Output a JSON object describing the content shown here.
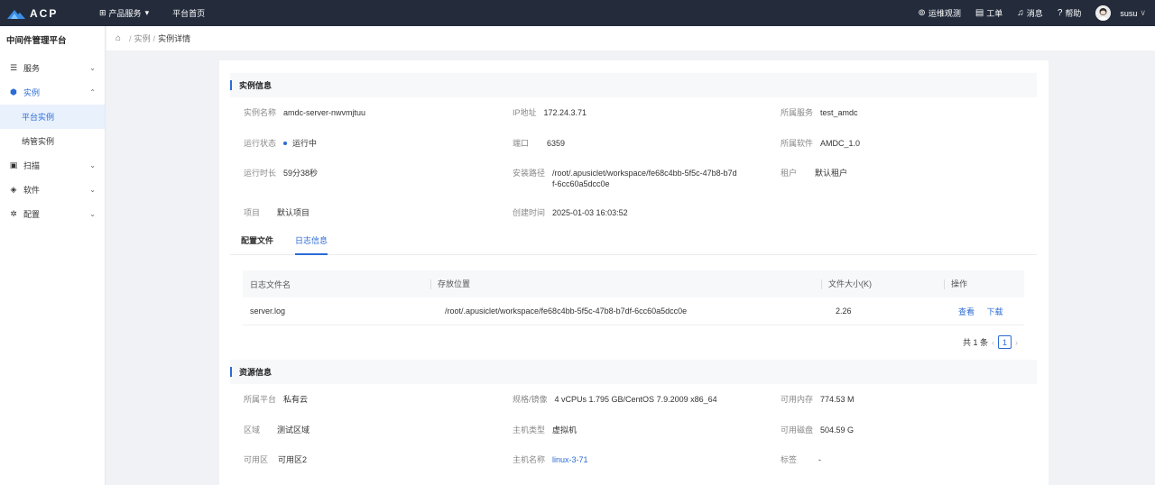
{
  "topbar": {
    "brand": "ACP",
    "nav": [
      {
        "icon": "grid-icon",
        "label": "产品服务",
        "caret": "▾"
      },
      {
        "label": "平台首页"
      }
    ],
    "right": [
      {
        "icon": "location-pin-icon",
        "label": "运维观测"
      },
      {
        "icon": "clipboard-icon",
        "label": "工单"
      },
      {
        "icon": "bell-icon",
        "label": "消息"
      },
      {
        "icon": "help-circle-icon",
        "label": "帮助"
      }
    ],
    "username": "susu",
    "user_caret": "∨"
  },
  "sidebar": {
    "title": "中间件管理平台",
    "items": [
      {
        "label": "服务",
        "icon": "server-icon",
        "state": "collapsed"
      },
      {
        "label": "实例",
        "icon": "hexagon-icon",
        "state": "expanded",
        "children": [
          "平台实例",
          "纳管实例"
        ],
        "active_child": "平台实例"
      },
      {
        "label": "扫描",
        "icon": "scan-icon",
        "state": "collapsed"
      },
      {
        "label": "软件",
        "icon": "box-icon",
        "state": "collapsed"
      },
      {
        "label": "配置",
        "icon": "gear-icon",
        "state": "collapsed"
      }
    ]
  },
  "breadcrumb": {
    "items": [
      "实例",
      "实例详情"
    ],
    "separator": "/"
  },
  "instance_info": {
    "title": "实例信息",
    "fields": {
      "name": {
        "label": "实例名称",
        "value": "amdc-server-nwvmjtuu"
      },
      "ip": {
        "label": "IP地址",
        "value": "172.24.3.71"
      },
      "service": {
        "label": "所属服务",
        "value": "test_amdc"
      },
      "status": {
        "label": "运行状态",
        "value": "运行中"
      },
      "port": {
        "label": "端口",
        "value": "6359"
      },
      "software": {
        "label": "所属软件",
        "value": "AMDC_1.0"
      },
      "uptime": {
        "label": "运行时长",
        "value": "59分38秒"
      },
      "install_path": {
        "label": "安装路径",
        "value": "/root/.apusiclet/workspace/fe68c4bb-5f5c-47b8-b7df-6cc60a5dcc0e"
      },
      "tenant": {
        "label": "租户",
        "value": "默认租户"
      },
      "project": {
        "label": "项目",
        "value": "默认项目"
      },
      "created": {
        "label": "创建时间",
        "value": "2025-01-03 16:03:52"
      }
    }
  },
  "tabs": {
    "items": [
      "配置文件",
      "日志信息"
    ],
    "active": "日志信息"
  },
  "log_table": {
    "columns": [
      "日志文件名",
      "存放位置",
      "文件大小(K)",
      "操作"
    ],
    "rows": [
      {
        "file": "server.log",
        "path": "/root/.apusiclet/workspace/fe68c4bb-5f5c-47b8-b7df-6cc60a5dcc0e",
        "size": "2.26",
        "actions": [
          "查看",
          "下载"
        ]
      }
    ]
  },
  "pagination": {
    "total_text": "共 1 条",
    "current_page": "1",
    "prev": "‹",
    "next": "›"
  },
  "resource_info": {
    "title": "资源信息",
    "fields": {
      "platform": {
        "label": "所属平台",
        "value": "私有云"
      },
      "spec": {
        "label": "规格/镜像",
        "value": "4 vCPUs 1.795 GB/CentOS 7.9.2009 x86_64"
      },
      "memory": {
        "label": "可用内存",
        "value": "774.53 M"
      },
      "region": {
        "label": "区域",
        "value": "测试区域"
      },
      "host_type": {
        "label": "主机类型",
        "value": "虚拟机"
      },
      "disk": {
        "label": "可用磁盘",
        "value": "504.59 G"
      },
      "zone": {
        "label": "可用区",
        "value": "可用区2"
      },
      "hostname": {
        "label": "主机名称",
        "value": "linux-3-71"
      },
      "tags": {
        "label": "标签",
        "value": "-"
      }
    }
  },
  "colors": {
    "topbar_bg": "#242c3c",
    "accent": "#2b6bd6",
    "page_bg": "#f0f2f5"
  }
}
